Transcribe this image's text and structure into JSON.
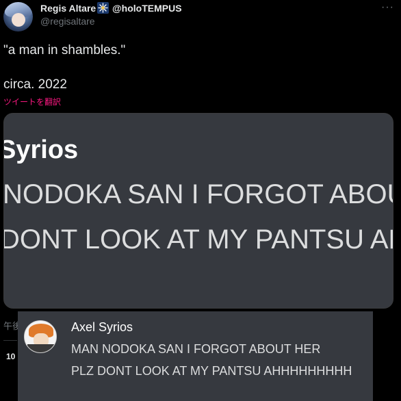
{
  "tweet": {
    "display_name": "Regis Altare",
    "badge_icon": "sparkle-badge-icon",
    "affiliation": "@holoTEMPUS",
    "handle": "@regisaltare",
    "more_icon": "more-dots-icon",
    "text_line1": "\"a man in shambles.\"",
    "text_line2": "circa. 2022",
    "translate_label": "ツイートを翻訳",
    "translate_color": "#f91880",
    "time_fragment": "午後",
    "count_fragment": "10"
  },
  "media": {
    "line1": "Syrios",
    "line2": "NODOKA SAN I FORGOT ABOUT",
    "line3": "DONT LOOK AT MY PANTSU AH"
  },
  "overlay": {
    "author": "Axel Syrios",
    "line1": "MAN NODOKA SAN I FORGOT ABOUT HER",
    "line2": "PLZ DONT LOOK AT MY PANTSU AHHHHHHHHH"
  }
}
